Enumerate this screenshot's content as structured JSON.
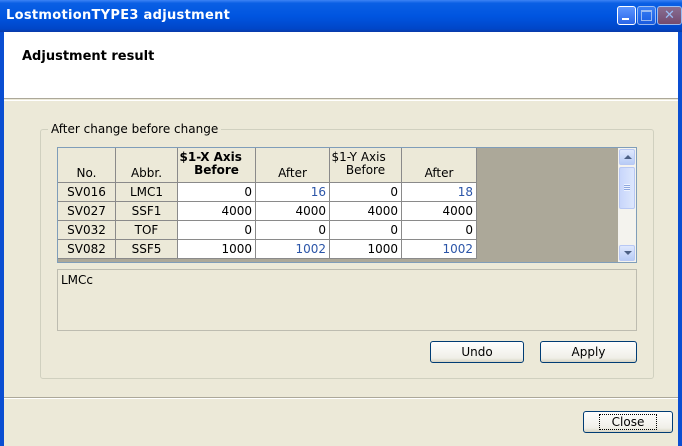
{
  "window": {
    "title": "LostmotionTYPE3 adjustment"
  },
  "header": {
    "title": "Adjustment result"
  },
  "group": {
    "label": "After change before change"
  },
  "grid": {
    "columns": {
      "no": "No.",
      "abbr": "Abbr.",
      "x_before_line1": "$1-X Axis",
      "x_before_line2": "Before",
      "x_after": "After",
      "y_before_line1": "$1-Y Axis",
      "y_before_line2": "Before",
      "y_after": "After"
    },
    "rows": [
      {
        "no": "SV016",
        "abbr": "LMC1",
        "x_before": "0",
        "x_after": "16",
        "y_before": "0",
        "y_after": "18"
      },
      {
        "no": "SV027",
        "abbr": "SSF1",
        "x_before": "4000",
        "x_after": "4000",
        "y_before": "4000",
        "y_after": "4000"
      },
      {
        "no": "SV032",
        "abbr": "TOF",
        "x_before": "0",
        "x_after": "0",
        "y_before": "0",
        "y_after": "0"
      },
      {
        "no": "SV082",
        "abbr": "SSF5",
        "x_before": "1000",
        "x_after": "1002",
        "y_before": "1000",
        "y_after": "1002"
      }
    ]
  },
  "description": {
    "text": "LMCc"
  },
  "buttons": {
    "undo": "Undo",
    "apply": "Apply",
    "close": "Close"
  },
  "colors": {
    "changed_value": "#2b55a8",
    "title_bar": "#0055e0"
  }
}
